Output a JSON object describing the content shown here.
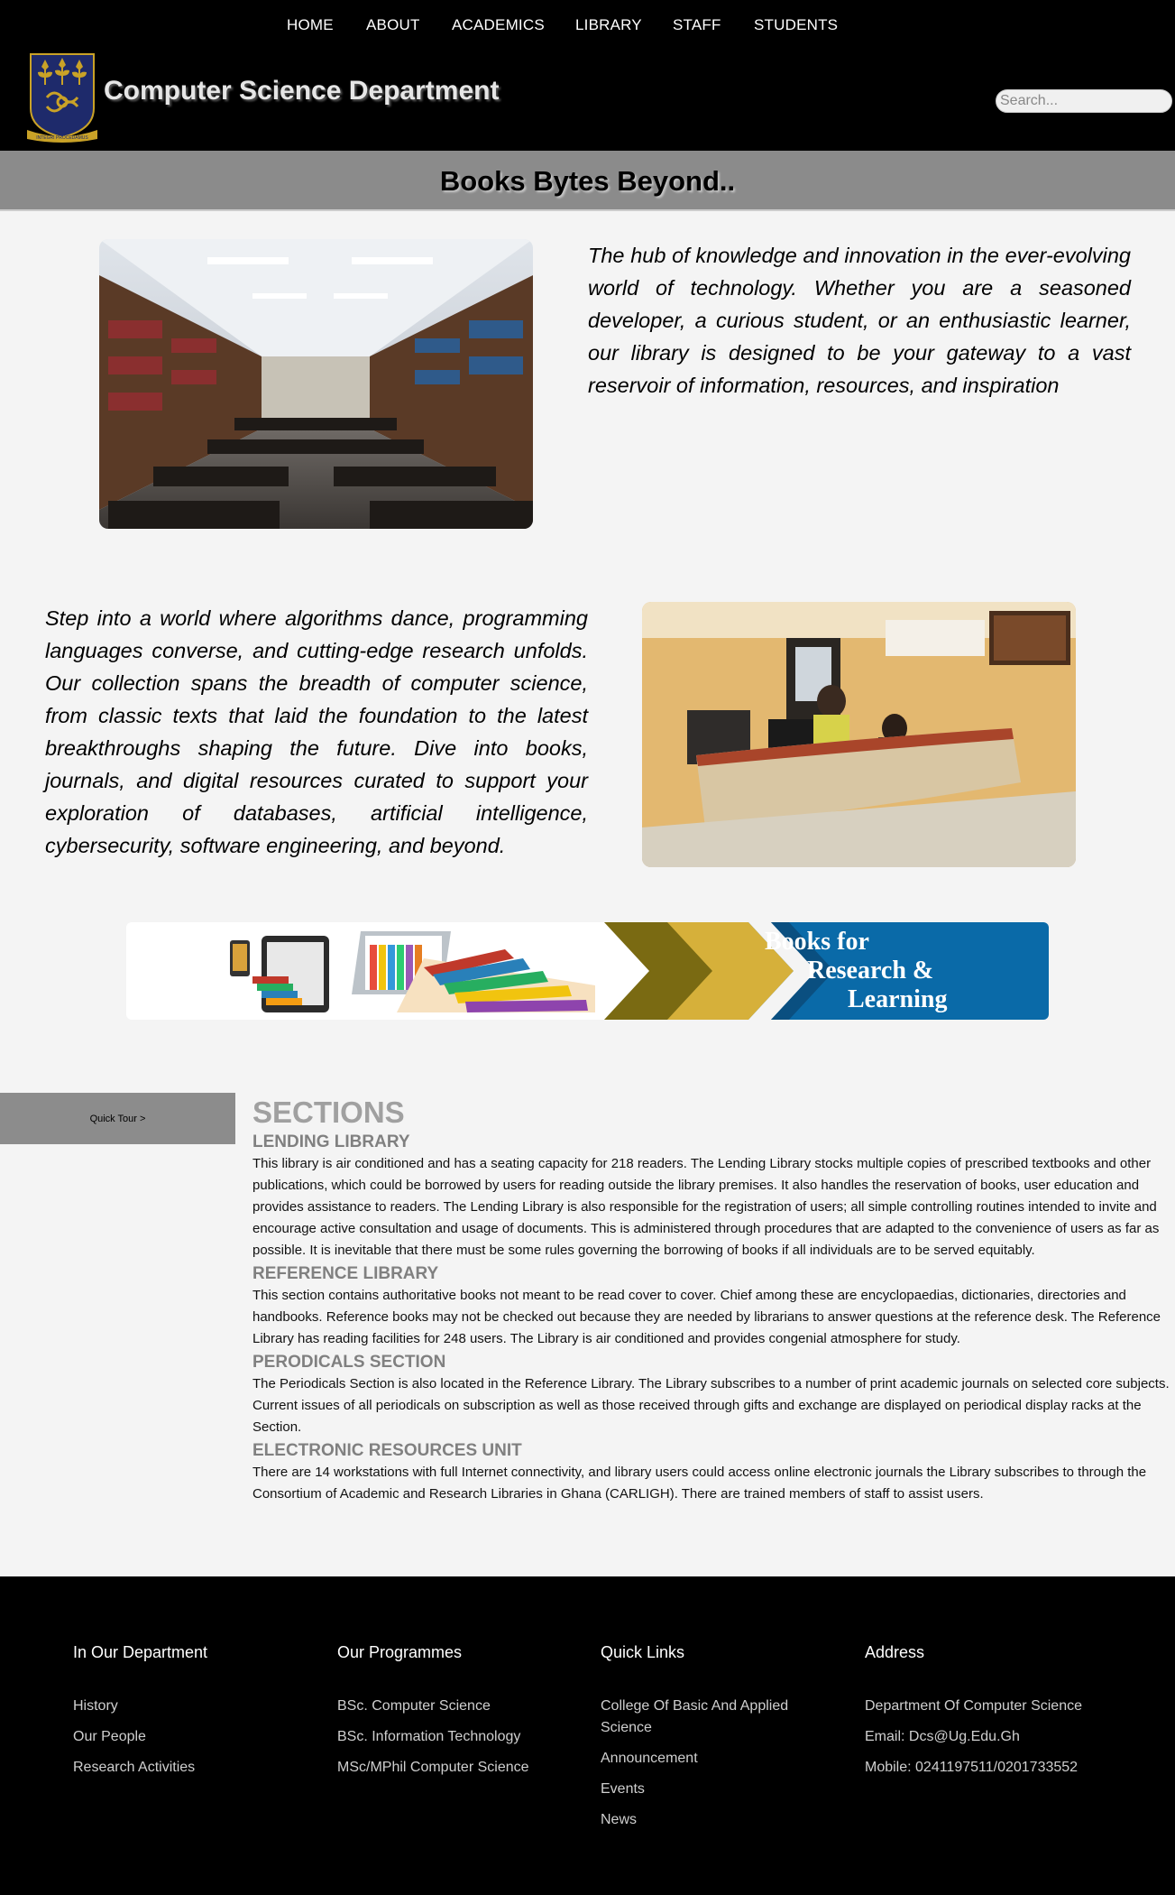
{
  "nav": {
    "items": [
      {
        "label": "HOME"
      },
      {
        "label": "ABOUT"
      },
      {
        "label": "ACADEMICS"
      },
      {
        "label": "LIBRARY"
      },
      {
        "label": "STAFF"
      },
      {
        "label": "STUDENTS"
      }
    ]
  },
  "header": {
    "title": "Computer Science Department",
    "search_placeholder": "Search...",
    "logo_motto": "INTEGRI PROCEDAMUS"
  },
  "banner": {
    "title": "Books Bytes Beyond.."
  },
  "intro": {
    "paragraph_1": "The hub of knowledge and innovation in the ever-evolving world of technology. Whether you are a seasoned developer, a curious student, or an enthusiastic learner, our library is designed to be your gateway to a vast reservoir of information, resources, and inspiration",
    "paragraph_2": "Step into a world where algorithms dance, programming languages converse, and cutting-edge research unfolds. Our collection spans the breadth of computer science, from classic texts that laid the foundation to the latest breakthroughs shaping the future. Dive into books, journals, and digital resources curated to support your exploration of databases, artificial intelligence, cybersecurity, software engineering, and beyond."
  },
  "ad_banner": {
    "line_1": "Books for",
    "line_2": "Research &",
    "line_3": "Learning"
  },
  "quick_tour": {
    "label": "Quick Tour >"
  },
  "sections": {
    "heading": "SECTIONS",
    "items": [
      {
        "title": "LENDING LIBRARY",
        "body": "This library is air conditioned and has a seating capacity for 218 readers. The Lending Library stocks multiple copies of prescribed textbooks and other publications, which could be borrowed by users for reading outside the library premises. It also handles the reservation of books, user education and provides assistance to readers. The Lending Library is also responsible for the registration of users; all simple controlling routines intended to invite and encourage active consultation and usage of documents. This is administered through procedures that are adapted to the convenience of users as far as possible. It is inevitable that there must be some rules governing the borrowing of books if all individuals are to be served equitably."
      },
      {
        "title": "REFERENCE LIBRARY",
        "body": "This section contains authoritative books not meant to be read cover to cover. Chief among these are encyclopaedias, dictionaries, directories and handbooks. Reference books may not be checked out because they are needed by librarians to answer questions at the reference desk. The Reference Library has reading facilities for 248 users. The Library is air conditioned and provides congenial atmosphere for study."
      },
      {
        "title": "PERODICALS SECTION",
        "body": "The Periodicals Section is also located in the Reference Library. The Library subscribes to a number of print academic journals on selected core subjects. Current issues of all periodicals on subscription as well as those received through gifts and exchange are displayed on periodical display racks at the Section."
      },
      {
        "title": "ELECTRONIC RESOURCES UNIT",
        "body": "There are 14 workstations with full Internet connectivity, and library users could access online electronic journals the Library subscribes to through the Consortium of Academic and Research Libraries in Ghana (CARLIGH). There are trained members of staff to assist users."
      }
    ]
  },
  "footer": {
    "department": {
      "title": "In Our Department",
      "links": [
        "History",
        "Our People",
        "Research Activities"
      ]
    },
    "programmes": {
      "title": "Our Programmes",
      "links": [
        "BSc. Computer Science",
        "BSc. Information Technology",
        "MSc/MPhil Computer Science"
      ]
    },
    "quick_links": {
      "title": "Quick Links",
      "links": [
        "College Of Basic And Applied Science",
        "Announcement",
        "Events",
        "News"
      ]
    },
    "address": {
      "title": "Address",
      "lines": [
        "Department Of Computer Science",
        "Email: Dcs@Ug.Edu.Gh",
        "Mobile: 0241197511/0201733552"
      ]
    }
  },
  "colors": {
    "header_bg": "#000000",
    "banner_bg": "#8b8b8b",
    "page_bg": "#f4f4f4",
    "section_heading": "#a0a0a0",
    "section_subheading": "#808080",
    "ad_blue": "#0a6aa8",
    "ad_gold": "#c9a227"
  }
}
